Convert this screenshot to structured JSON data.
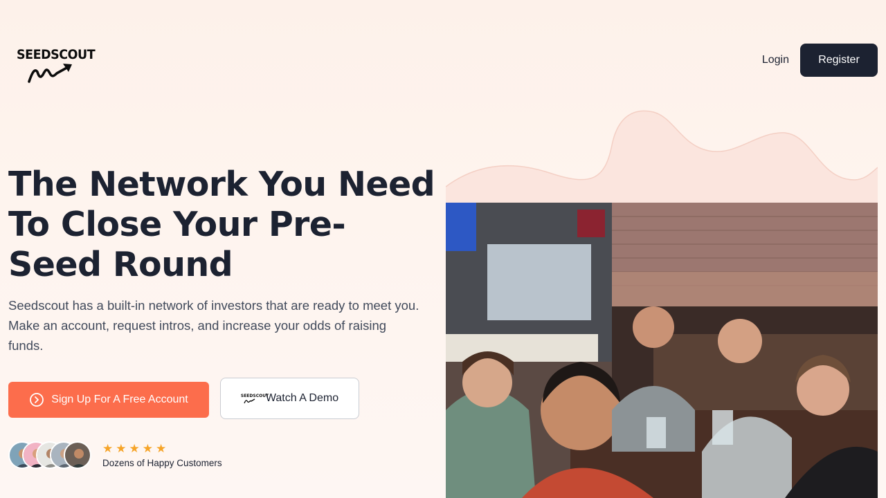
{
  "brand": {
    "logo_text": "SEEDSCOUT"
  },
  "nav": {
    "login_label": "Login",
    "register_label": "Register"
  },
  "hero": {
    "title": "The Network You Need To Close Your Pre-Seed Round",
    "description": "Seedscout has a built-in network of investors that are ready to meet you. Make an account, request intros, and increase your odds of raising funds.",
    "signup_label": "Sign Up For A Free Account",
    "demo_label": "Watch A Demo",
    "demo_logo_text": "SEEDSCOUT"
  },
  "social_proof": {
    "rating": 5,
    "stars": [
      "★",
      "★",
      "★",
      "★",
      "★"
    ],
    "caption": "Dozens of Happy Customers"
  },
  "colors": {
    "accent": "#fc6d4c",
    "dark": "#1c2231",
    "star": "#f6a428",
    "background": "#fdf1ea"
  },
  "icons": {
    "logo": "trending-arrow-icon",
    "signup": "chevron-circle-right-icon"
  }
}
